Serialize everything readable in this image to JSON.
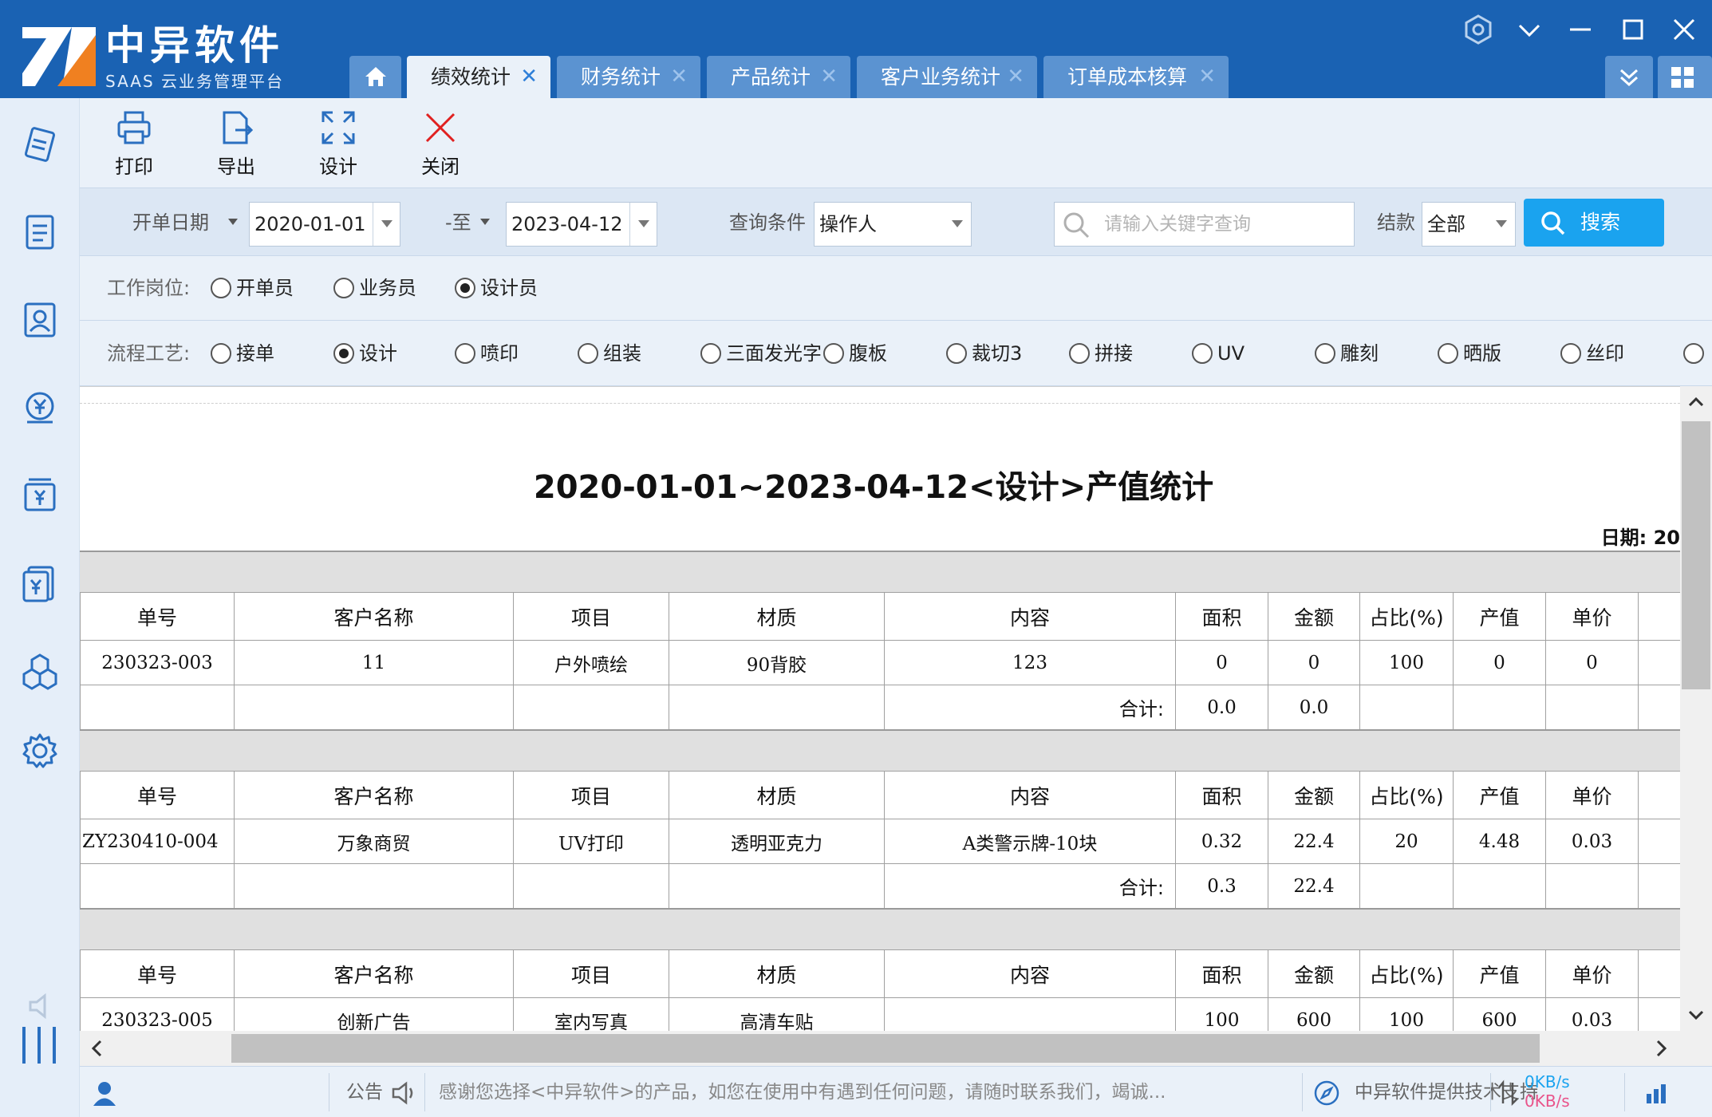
{
  "app": {
    "name": "中异软件",
    "subtitle": "SAAS 云业务管理平台",
    "colors": {
      "titlebar": "#1a62b3",
      "tab": "#5b93d1",
      "accent": "#1aa3ef",
      "logo_orange": "#f08020"
    }
  },
  "tabs": [
    {
      "label": "绩效统计",
      "active": true
    },
    {
      "label": "财务统计",
      "active": false
    },
    {
      "label": "产品统计",
      "active": false
    },
    {
      "label": "客户业务统计",
      "active": false
    },
    {
      "label": "订单成本核算",
      "active": false
    }
  ],
  "toolbar": {
    "print": "打印",
    "export": "导出",
    "design": "设计",
    "close": "关闭"
  },
  "filter": {
    "date_label": "开单日期",
    "date_from": "2020-01-01",
    "to_label": "-至",
    "date_to": "2023-04-12",
    "query_label": "查询条件",
    "query_value": "操作人",
    "search_placeholder": "请输入关键字查询",
    "settle_label": "结款",
    "settle_value": "全部",
    "search_button": "搜索"
  },
  "position_row": {
    "label": "工作岗位:",
    "options": [
      {
        "label": "开单员",
        "checked": false
      },
      {
        "label": "业务员",
        "checked": false
      },
      {
        "label": "设计员",
        "checked": true
      }
    ]
  },
  "process_row": {
    "label": "流程工艺:",
    "options": [
      {
        "label": "接单",
        "checked": false
      },
      {
        "label": "设计",
        "checked": true
      },
      {
        "label": "喷印",
        "checked": false
      },
      {
        "label": "组装",
        "checked": false
      },
      {
        "label": "三面发光字",
        "checked": false
      },
      {
        "label": "腹板",
        "checked": false
      },
      {
        "label": "裁切3",
        "checked": false
      },
      {
        "label": "拼接",
        "checked": false
      },
      {
        "label": "UV",
        "checked": false
      },
      {
        "label": "雕刻",
        "checked": false
      },
      {
        "label": "晒版",
        "checked": false
      },
      {
        "label": "丝印",
        "checked": false
      }
    ]
  },
  "report": {
    "title": "2020-01-01~2023-04-12<设计>产值统计",
    "date_label": "日期: 20",
    "headers": [
      "单号",
      "客户名称",
      "项目",
      "材质",
      "内容",
      "面积",
      "金额",
      "占比(%)",
      "产值",
      "单价"
    ],
    "sum_label": "合计:",
    "groups": [
      {
        "rows": [
          [
            "230323-003",
            "11",
            "户外喷绘",
            "90背胶",
            "123",
            "0",
            "0",
            "100",
            "0",
            "0"
          ]
        ],
        "sum_area": "0.0",
        "sum_amount": "0.0"
      },
      {
        "rows": [
          [
            "ZY230410-004",
            "万象商贸",
            "UV打印",
            "透明亚克力",
            "A类警示牌-10块",
            "0.32",
            "22.4",
            "20",
            "4.48",
            "0.03"
          ]
        ],
        "sum_area": "0.3",
        "sum_amount": "22.4"
      },
      {
        "rows": [
          [
            "230323-005",
            "创新广告",
            "室内写真",
            "高清车贴",
            "",
            "100",
            "600",
            "100",
            "600",
            "0.03"
          ]
        ]
      }
    ]
  },
  "status": {
    "notice_label": "公告",
    "notice_text": "感谢您选择<中异软件>的产品，如您在使用中有遇到任何问题，请随时联系我们，竭诚...",
    "support_text": "中异软件提供技术支持",
    "net_up": "0KB/s",
    "net_down": "0KB/s"
  }
}
